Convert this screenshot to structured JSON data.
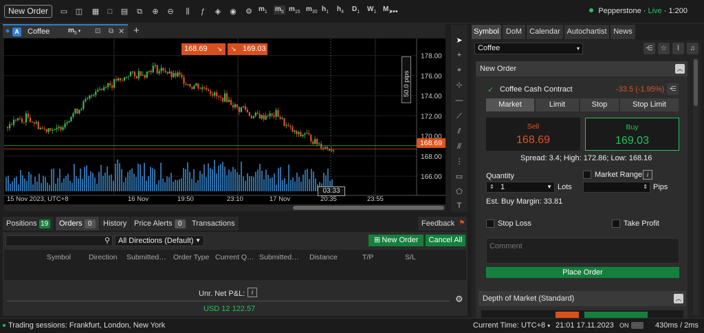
{
  "toolbar": {
    "new_order_label": "New Order",
    "timeframes": [
      {
        "letter": "m",
        "sub": "1"
      },
      {
        "letter": "m",
        "sub": "5"
      },
      {
        "letter": "m",
        "sub": "15"
      },
      {
        "letter": "m",
        "sub": "30"
      },
      {
        "letter": "h",
        "sub": "1"
      },
      {
        "letter": "h",
        "sub": "4"
      },
      {
        "letter": "D",
        "sub": "1"
      },
      {
        "letter": "W",
        "sub": "1"
      },
      {
        "letter": "M",
        "sub": "1"
      }
    ],
    "more": "•••",
    "broker": "Pepperstone",
    "live": "Live",
    "leverage": "1:200"
  },
  "chart_tab": {
    "badge": "A",
    "symbol": "Coffee",
    "timeframe_letter": "m",
    "timeframe_sub": "5",
    "add": "+"
  },
  "chart": {
    "sell_price": "168.69",
    "buy_price": "169.03",
    "pips_label": "50.0 pips",
    "current_price_label": "168.69",
    "cursor_time": "03:33",
    "accent_up": "#3dbd54",
    "accent_down": "#e0531f",
    "chart_data": {
      "type": "candlestick",
      "y_ticks": [
        "178.00",
        "176.00",
        "174.00",
        "172.00",
        "170.00",
        "168.00",
        "166.00"
      ],
      "x_ticks": [
        "15 Nov 2023, UTC+8",
        "16 Nov",
        "19:50",
        "23:10",
        "17 Nov",
        "20:35",
        "23:55"
      ],
      "ylim": [
        164.5,
        179
      ],
      "current_price": 168.69,
      "close_path": [
        170.9,
        171.3,
        171.8,
        171.3,
        172.0,
        171.6,
        171.2,
        170.8,
        170.6,
        170.9,
        170.4,
        170.8,
        171.3,
        171.8,
        172.3,
        172.6,
        173.2,
        173.6,
        174.2,
        174.8,
        174.6,
        175.3,
        175.0,
        175.6,
        175.3,
        175.9,
        176.3,
        175.8,
        176.4,
        176.1,
        176.5,
        176.9,
        176.4,
        176.7,
        176.2,
        175.9,
        176.1,
        175.6,
        175.3,
        174.9,
        175.1,
        174.7,
        174.9,
        174.4,
        174.0,
        173.6,
        173.9,
        173.4,
        173.0,
        172.6,
        172.9,
        172.2,
        171.9,
        172.1,
        171.8,
        172.2,
        171.9,
        172.3,
        171.6,
        171.0,
        170.6,
        170.2,
        170.0,
        170.3,
        169.8,
        169.4,
        169.2,
        168.9,
        168.8,
        168.69
      ]
    }
  },
  "bottom": {
    "tabs": [
      {
        "label": "Positions",
        "badge": "19"
      },
      {
        "label": "Orders",
        "badge": "0"
      },
      {
        "label": "History",
        "badge": ""
      },
      {
        "label": "Price Alerts",
        "badge": "0"
      },
      {
        "label": "Transactions",
        "badge": ""
      }
    ],
    "feedback": "Feedback",
    "direction_select": "All Directions (Default)",
    "new_order_btn": "New Order",
    "cancel_all_btn": "Cancel All",
    "columns": [
      "Symbol",
      "Direction",
      "Submitted…",
      "Order Type",
      "Current Q…",
      "Submitted…",
      "Distance",
      "T/P",
      "S/L"
    ],
    "unr_label": "Unr. Net P&L:",
    "unr_value": "USD 12 122.57"
  },
  "status": {
    "sessions": "Trading sessions: Frankfurt, London, New York",
    "current_time_label": "Current Time:",
    "tz": "UTC+8",
    "datetime": "21:01 17.11.2023",
    "on": "ON",
    "latency": "430ms / 2ms"
  },
  "right_panel": {
    "tabs": [
      "Symbol",
      "DoM",
      "Calendar",
      "Autochartist",
      "News"
    ],
    "symbol_select": "Coffee",
    "new_order_head": "New Order",
    "contract": "Coffee Cash Contract",
    "change": "-33.5 (-1.95%)",
    "order_types": [
      "Market",
      "Limit",
      "Stop",
      "Stop Limit"
    ],
    "sell_label": "Sell",
    "sell_value": "168.69",
    "buy_label": "Buy",
    "buy_value": "169.03",
    "spread_line": "Spread: 3.4; High: 172.86; Low: 168.16",
    "quantity_label": "Quantity",
    "quantity_value": "1",
    "lots_label": "Lots",
    "market_range_label": "Market Range",
    "pips_label": "Pips",
    "margin_line": "Est. Buy Margin: 33.81",
    "stop_loss_label": "Stop Loss",
    "take_profit_label": "Take Profit",
    "comment_placeholder": "Comment",
    "place_order_label": "Place Order",
    "dom_head": "Depth of Market (Standard)"
  }
}
